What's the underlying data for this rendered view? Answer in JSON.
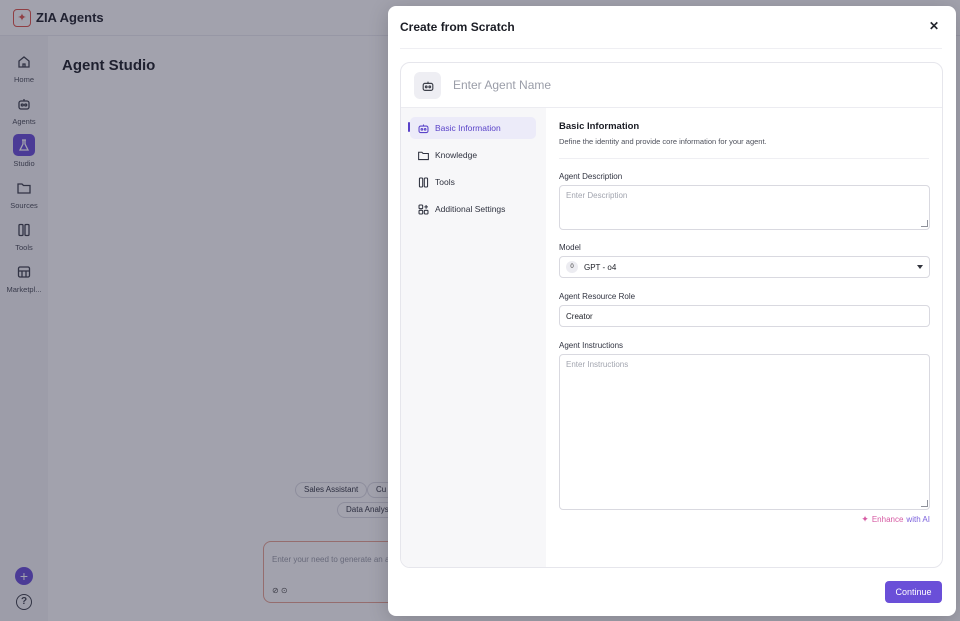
{
  "app": {
    "title": "ZIA Agents"
  },
  "nav": {
    "items": [
      {
        "label": "Home",
        "icon": "home-icon"
      },
      {
        "label": "Agents",
        "icon": "robot-icon"
      },
      {
        "label": "Studio",
        "icon": "flask-icon",
        "active": true
      },
      {
        "label": "Sources",
        "icon": "folder-icon"
      },
      {
        "label": "Tools",
        "icon": "tools-icon"
      },
      {
        "label": "Marketpl...",
        "icon": "store-icon"
      }
    ],
    "add_icon": "plus-icon",
    "help_icon": "help-icon"
  },
  "page": {
    "title": "Agent Studio",
    "chips": [
      "Sales Assistant",
      "Cu",
      "Data Analys"
    ],
    "prompt_placeholder": "Enter your need to generate an a"
  },
  "modal": {
    "title": "Create from Scratch",
    "close_icon": "close-icon",
    "agent_name_placeholder": "Enter Agent Name",
    "side_items": [
      {
        "label": "Basic Information",
        "icon": "robot-icon",
        "active": true
      },
      {
        "label": "Knowledge",
        "icon": "folder-icon"
      },
      {
        "label": "Tools",
        "icon": "tools-icon"
      },
      {
        "label": "Additional Settings",
        "icon": "settings-grid-icon"
      }
    ],
    "section": {
      "title": "Basic Information",
      "subtitle": "Define the identity and provide core information for your agent."
    },
    "fields": {
      "description_label": "Agent Description",
      "description_placeholder": "Enter Description",
      "model_label": "Model",
      "model_badge": "0",
      "model_value": "GPT - o4",
      "role_label": "Agent Resource Role",
      "role_value": "Creator",
      "instructions_label": "Agent Instructions",
      "instructions_placeholder": "Enter Instructions"
    },
    "enhance": {
      "part1": "Enhance",
      "part2": "with AI"
    },
    "continue_label": "Continue"
  },
  "colors": {
    "accent": "#6a4fd8",
    "logo": "#e0554a",
    "enhance_pink": "#d65aa3"
  }
}
